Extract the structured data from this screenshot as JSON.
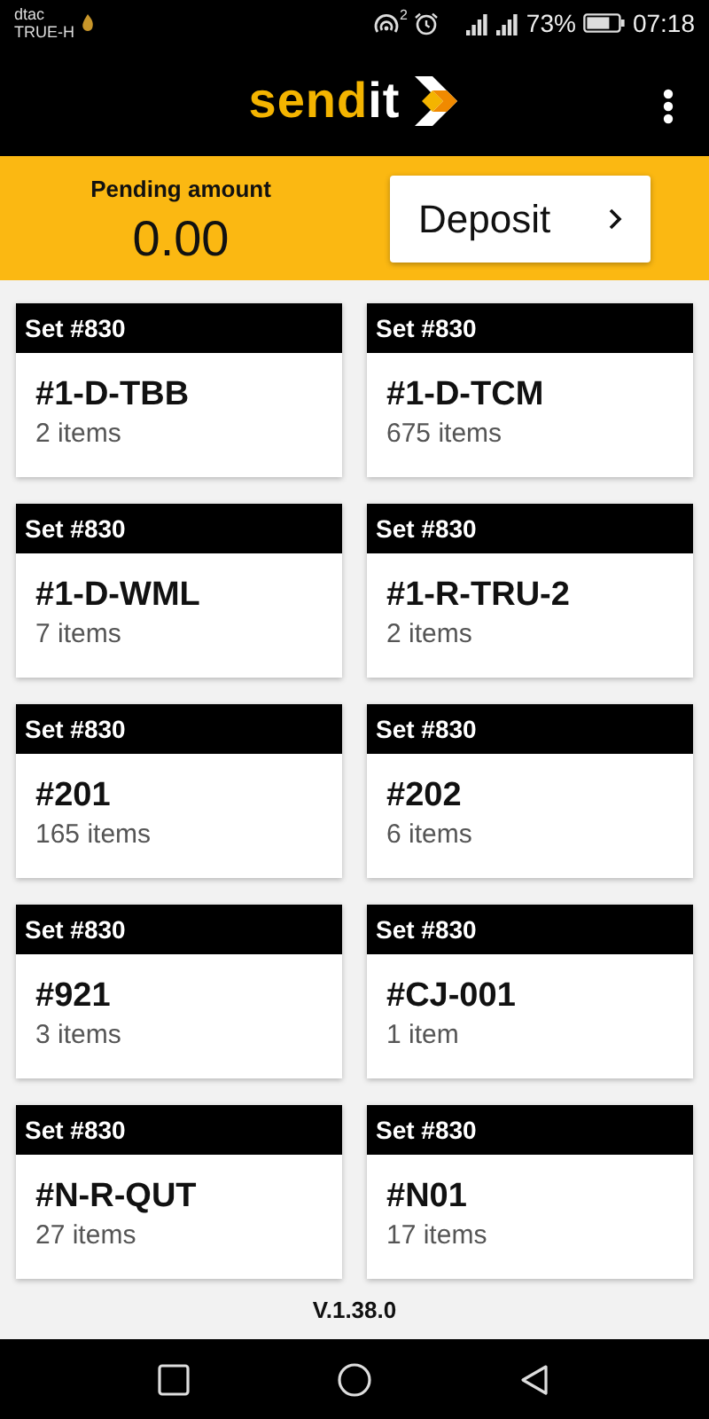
{
  "status_bar": {
    "carrier_top": "dtac",
    "carrier_bottom": "TRUE-H",
    "hotspot_count": "2",
    "battery": "73%",
    "time": "07:18"
  },
  "app_bar": {
    "logo_main": "send",
    "logo_accent": "it"
  },
  "summary": {
    "label": "Pending amount",
    "amount": "0.00",
    "button": "Deposit"
  },
  "sets": [
    {
      "set": "Set #830",
      "code": "#1-D-TBB",
      "count": "2 items"
    },
    {
      "set": "Set #830",
      "code": "#1-D-TCM",
      "count": "675 items"
    },
    {
      "set": "Set #830",
      "code": "#1-D-WML",
      "count": "7 items"
    },
    {
      "set": "Set #830",
      "code": "#1-R-TRU-2",
      "count": "2 items"
    },
    {
      "set": "Set #830",
      "code": "#201",
      "count": "165 items"
    },
    {
      "set": "Set #830",
      "code": "#202",
      "count": "6 items"
    },
    {
      "set": "Set #830",
      "code": "#921",
      "count": "3 items"
    },
    {
      "set": "Set #830",
      "code": "#CJ-001",
      "count": "1 item"
    },
    {
      "set": "Set #830",
      "code": "#N-R-QUT",
      "count": "27 items"
    },
    {
      "set": "Set #830",
      "code": "#N01",
      "count": "17 items"
    }
  ],
  "version": "V.1.38.0"
}
